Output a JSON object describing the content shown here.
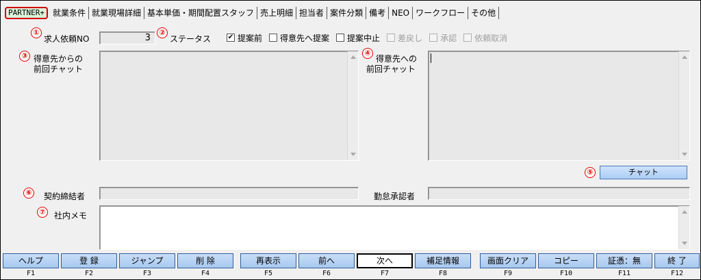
{
  "tabs": [
    "PARTNER+",
    "就業条件",
    "就業現場詳細",
    "基本単価・期間配置スタッフ",
    "売上明細",
    "担当者",
    "案件分類",
    "備考",
    "NEO",
    "ワークフロー",
    "その他"
  ],
  "badges": [
    "①",
    "②",
    "③",
    "④",
    "⑤",
    "⑥",
    "⑦"
  ],
  "fields": {
    "request_no_label": "求人依頼NO",
    "request_no_value": "3",
    "status_label": "ステータス",
    "chat_from_label_1": "得意先からの",
    "chat_from_label_2": "前回チャット",
    "chat_to_label_1": "得意先への",
    "chat_to_label_2": "前回チャット",
    "contract_label": "契約締結者",
    "approver_label": "勤怠承認者",
    "memo_label": "社内メモ"
  },
  "status_options": [
    {
      "label": "提案前",
      "checked": true,
      "disabled": false
    },
    {
      "label": "得意先へ提案",
      "checked": false,
      "disabled": false
    },
    {
      "label": "提案中止",
      "checked": false,
      "disabled": false
    },
    {
      "label": "差戻し",
      "checked": false,
      "disabled": true
    },
    {
      "label": "承認",
      "checked": false,
      "disabled": true
    },
    {
      "label": "依頼取消",
      "checked": false,
      "disabled": true
    }
  ],
  "chat_button": "チャット",
  "fkeys": [
    {
      "label": "ヘルプ",
      "key": "F1"
    },
    {
      "label": "登 録",
      "key": "F2"
    },
    {
      "label": "ジャンプ",
      "key": "F3"
    },
    {
      "label": "削 除",
      "key": "F4"
    },
    {
      "label": "再表示",
      "key": "F5"
    },
    {
      "label": "前へ",
      "key": "F6"
    },
    {
      "label": "次へ",
      "key": "F7"
    },
    {
      "label": "補足情報",
      "key": "F8"
    },
    {
      "label": "画面クリア",
      "key": "F9"
    },
    {
      "label": "コピー",
      "key": "F10"
    },
    {
      "label": "証憑：無",
      "key": "F11"
    },
    {
      "label": "終 了",
      "key": "F12"
    }
  ],
  "colors": {
    "badge": "#e00000",
    "button": "#aacdf5",
    "tab_highlight": "#d20000"
  }
}
